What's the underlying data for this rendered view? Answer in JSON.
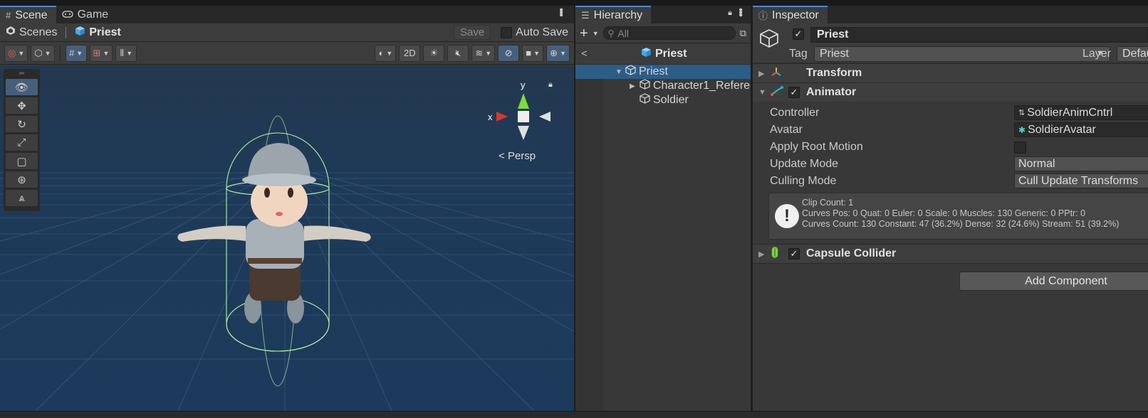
{
  "scene_panel": {
    "tabs": [
      {
        "label": "Scene",
        "icon": "grid-icon"
      },
      {
        "label": "Game",
        "icon": "gamepad-icon"
      }
    ],
    "breadcrumb": {
      "root": "Scenes",
      "current": "Priest"
    },
    "save_label": "Save",
    "autosave_label": "Auto Save",
    "toolbar": {
      "mode_2d": "2D"
    },
    "gizmo": {
      "x_label": "x",
      "y_label": "y"
    },
    "projection_label": "Persp"
  },
  "hierarchy": {
    "tab_label": "Hierarchy",
    "search_placeholder": "All",
    "prefab_title": "Priest",
    "items": [
      {
        "name": "Priest",
        "selected": true
      },
      {
        "name": "Character1_Refere"
      },
      {
        "name": "Soldier"
      }
    ]
  },
  "inspector": {
    "tab_label": "Inspector",
    "object_name": "Priest",
    "tag_label": "Tag",
    "tag_value": "Priest",
    "layer_label": "Layer",
    "layer_value": "Defau",
    "components": {
      "transform": "Transform",
      "animator": "Animator",
      "capsule_collider": "Capsule Collider"
    },
    "animator_props": [
      {
        "label": "Controller",
        "value": "SoldierAnimCntrl"
      },
      {
        "label": "Avatar",
        "value": "SoldierAvatar"
      },
      {
        "label": "Apply Root Motion"
      },
      {
        "label": "Update Mode",
        "value": "Normal"
      },
      {
        "label": "Culling Mode",
        "value": "Cull Update Transforms"
      }
    ],
    "help": {
      "line1": "Clip Count: 1",
      "line2": "Curves Pos: 0 Quat: 0 Euler: 0 Scale: 0 Muscles: 130 Generic: 0 PPtr: 0",
      "line3": "Curves Count: 130 Constant: 47 (36.2%) Dense: 32 (24.6%) Stream: 51 (39.2%)"
    },
    "add_component_label": "Add Component"
  },
  "colors": {
    "selection": "#2c5d87",
    "active_tab_accent": "#4a8bd6",
    "viewport_sky": "#1c3b5c"
  }
}
